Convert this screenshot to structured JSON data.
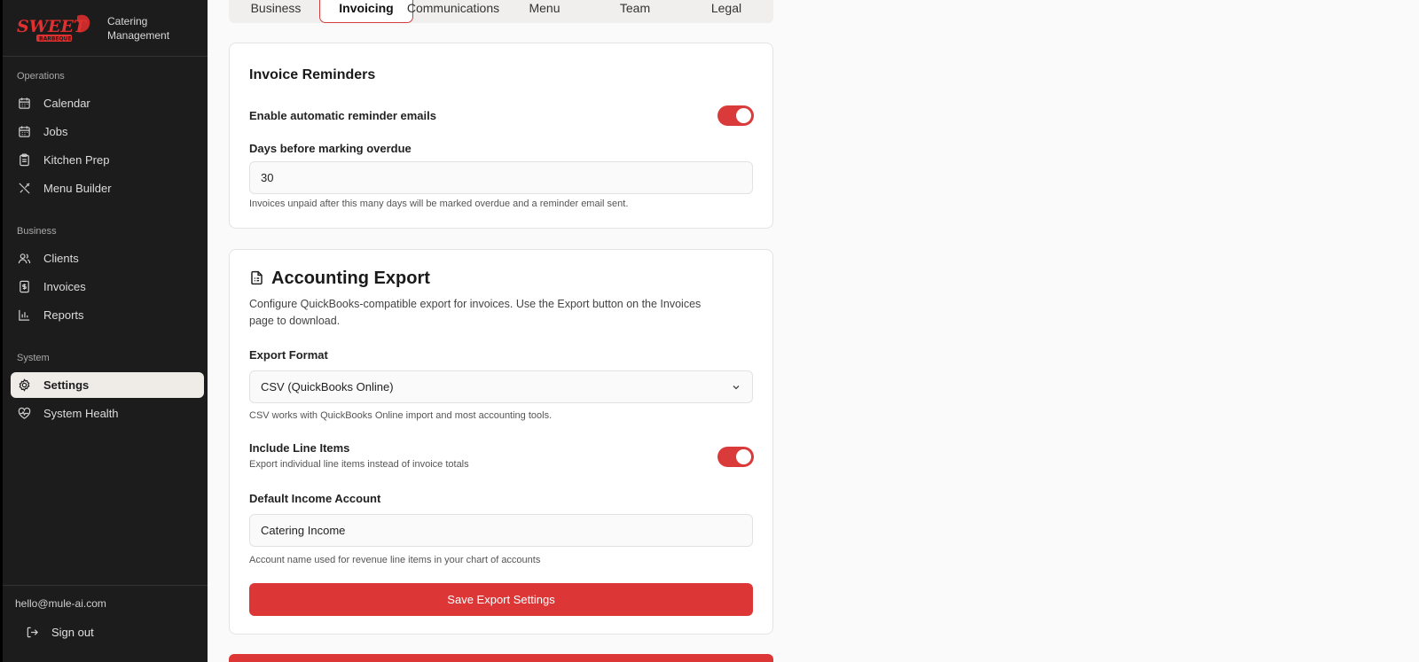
{
  "brand": {
    "logo_text": "SWEET",
    "logo_sub": "BARBEQUE",
    "line1": "Catering",
    "line2": "Management"
  },
  "sidebar": {
    "sections": [
      "Operations",
      "Business",
      "System"
    ],
    "items": [
      {
        "label": "Calendar",
        "icon": "calendar-icon"
      },
      {
        "label": "Jobs",
        "icon": "calendar-icon"
      },
      {
        "label": "Kitchen Prep",
        "icon": "clipboard-icon"
      },
      {
        "label": "Menu Builder",
        "icon": "utensils-icon"
      },
      {
        "label": "Clients",
        "icon": "users-icon"
      },
      {
        "label": "Invoices",
        "icon": "invoice-icon"
      },
      {
        "label": "Reports",
        "icon": "bar-chart-icon"
      },
      {
        "label": "Settings",
        "icon": "gear-icon",
        "active": true
      },
      {
        "label": "System Health",
        "icon": "heart-pulse-icon"
      }
    ],
    "email": "hello@mule-ai.com",
    "signout": "Sign out"
  },
  "tabs": [
    {
      "label": "Business"
    },
    {
      "label": "Invoicing",
      "active": true
    },
    {
      "label": "Communications"
    },
    {
      "label": "Menu"
    },
    {
      "label": "Team"
    },
    {
      "label": "Legal"
    }
  ],
  "reminders": {
    "title": "Invoice Reminders",
    "toggle_label": "Enable automatic reminder emails",
    "toggle_on": true,
    "days_label": "Days before marking overdue",
    "days_value": "30",
    "days_hint": "Invoices unpaid after this many days will be marked overdue and a reminder email sent."
  },
  "export": {
    "title": "Accounting Export",
    "description_line1": "Configure QuickBooks-compatible export for invoices. Use the Export button on the Invoices",
    "description_line2": "page to download.",
    "format_label": "Export Format",
    "format_value": "CSV (QuickBooks Online)",
    "format_hint": "CSV works with QuickBooks Online import and most accounting tools.",
    "line_items_label": "Include Line Items",
    "line_items_hint": "Export individual line items instead of invoice totals",
    "line_items_on": true,
    "account_label": "Default Income Account",
    "account_value": "Catering Income",
    "account_hint": "Account name used for revenue line items in your chart of accounts",
    "save_label": "Save Export Settings"
  },
  "colors": {
    "accent": "#dc3636",
    "sidebar_bg": "#1c1c1c",
    "active_bg": "#efece8"
  }
}
